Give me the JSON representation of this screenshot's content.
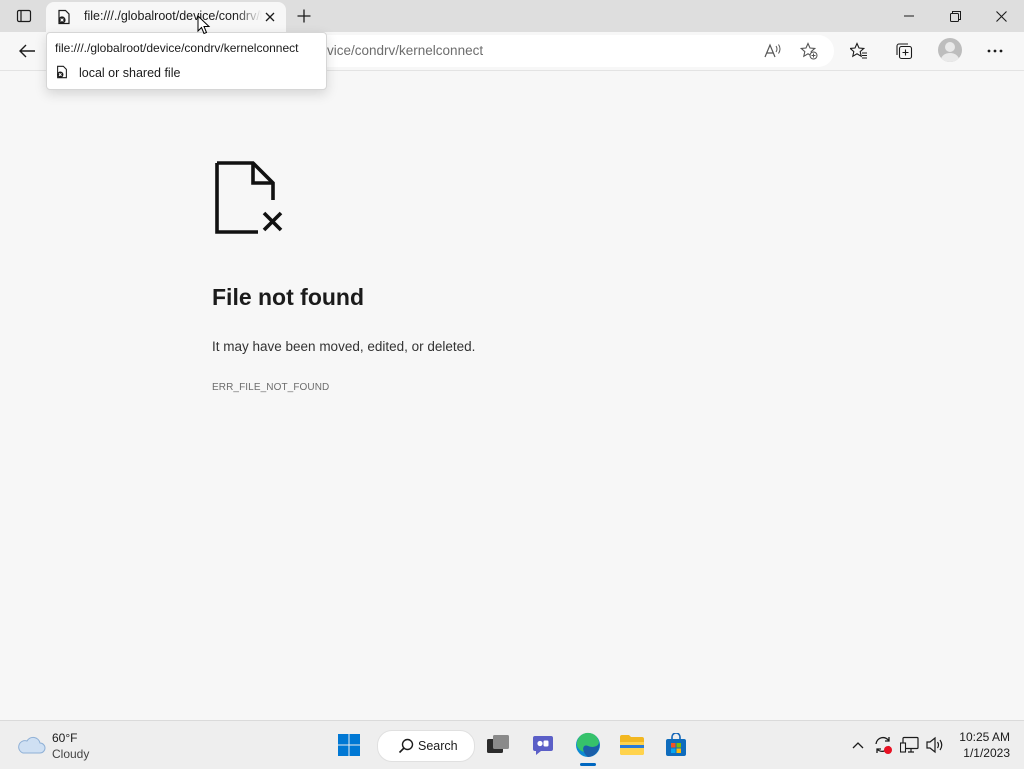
{
  "tab": {
    "title": "file:///./globalroot/device/condrv/kernelconnect",
    "favicon": "file-error-icon"
  },
  "tooltip": {
    "url": "file:///./globalroot/device/condrv/kernelconnect",
    "description": "local or shared file"
  },
  "address_bar": {
    "visible_text": "vice/condrv/kernelconnect"
  },
  "error_page": {
    "title": "File not found",
    "description": "It may have been moved, edited, or deleted.",
    "code": "ERR_FILE_NOT_FOUND"
  },
  "taskbar": {
    "weather": {
      "temperature": "60°F",
      "condition": "Cloudy"
    },
    "search_label": "Search",
    "clock": {
      "time": "10:25 AM",
      "date": "1/1/2023"
    }
  },
  "colors": {
    "accent": "#0067c0",
    "tab_strip": "#dedede",
    "page_bg": "#f7f7f7",
    "notification_red": "#e81123"
  }
}
